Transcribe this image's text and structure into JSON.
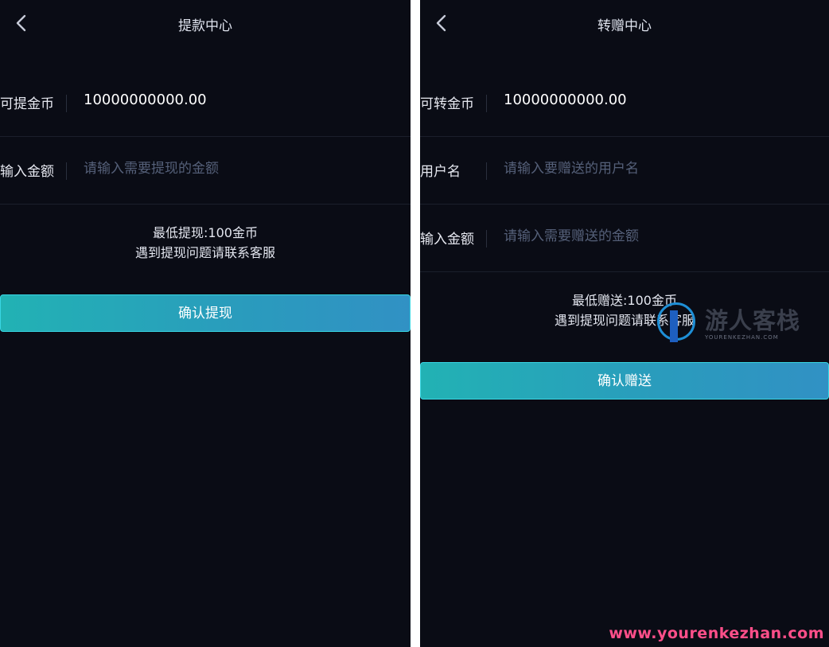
{
  "left": {
    "header": {
      "title": "提款中心"
    },
    "available": {
      "label": "可提金币",
      "value": "10000000000.00"
    },
    "amount": {
      "label": "输入金额",
      "placeholder": "请输入需要提现的金额",
      "value": ""
    },
    "notes": {
      "line1": "最低提现:100金币",
      "line2": "遇到提现问题请联系客服"
    },
    "confirm_label": "确认提现"
  },
  "right": {
    "header": {
      "title": "转赠中心"
    },
    "available": {
      "label": "可转金币",
      "value": "10000000000.00"
    },
    "username": {
      "label": "用户名",
      "placeholder": "请输入要赠送的用户名",
      "value": ""
    },
    "amount": {
      "label": "输入金额",
      "placeholder": "请输入需要赠送的金额",
      "value": ""
    },
    "notes": {
      "line1": "最低赠送:100金币",
      "line2": "遇到提现问题请联系客服"
    },
    "confirm_label": "确认赠送"
  },
  "watermark": {
    "brand": "游人客栈",
    "sub": "YOURENKEZHAN.COM",
    "site": "www.yourenkezhan.com"
  },
  "icons": {
    "back": "chevron-left-icon"
  },
  "colors": {
    "background": "#0a0c15",
    "button_start": "#22b2b4",
    "button_end": "#3191c4",
    "button_border": "#38d6e3",
    "placeholder": "#556079"
  }
}
